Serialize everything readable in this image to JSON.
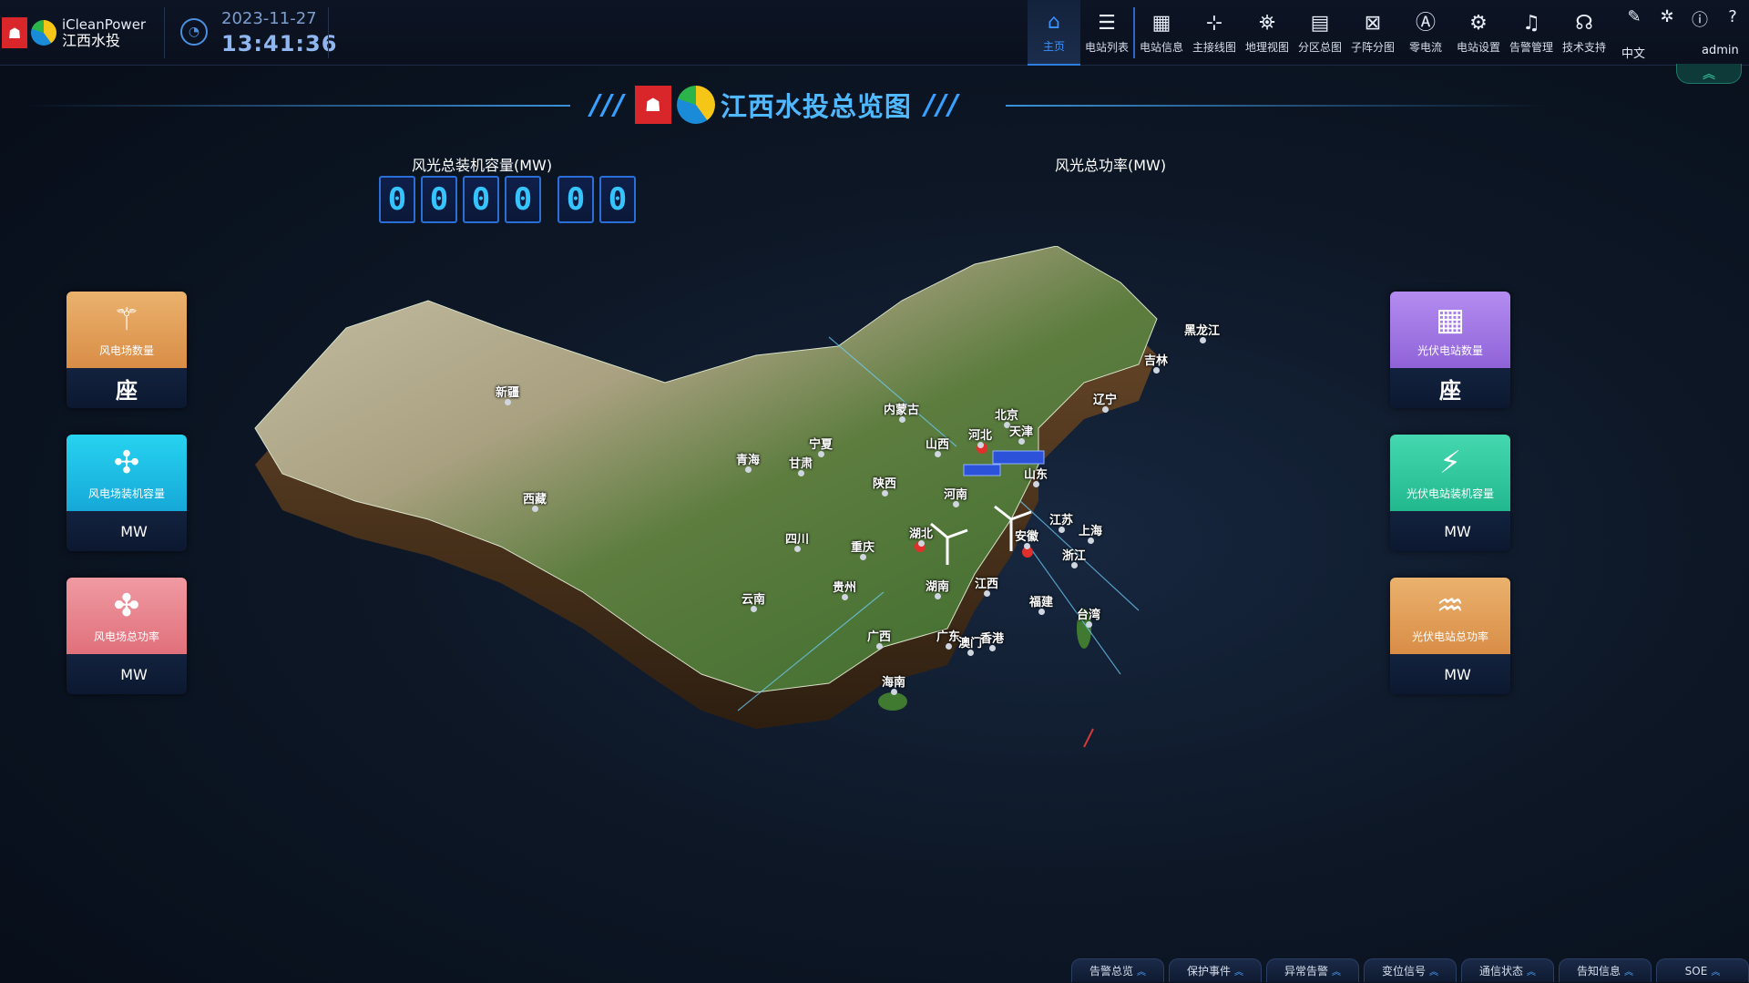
{
  "header": {
    "brand_en": "iCleanPower",
    "brand_cn": "江西水投",
    "date": "2023-11-27",
    "time": "13:41:36",
    "nav": [
      {
        "label": "主页",
        "icon": "⌂",
        "active": true
      },
      {
        "label": "电站列表",
        "icon": "☰"
      },
      {
        "label": "电站信息",
        "icon": "▦"
      },
      {
        "label": "主接线图",
        "icon": "⊹"
      },
      {
        "label": "地理视图",
        "icon": "⛯"
      },
      {
        "label": "分区总图",
        "icon": "▤"
      },
      {
        "label": "子阵分图",
        "icon": "⊠"
      },
      {
        "label": "零电流",
        "icon": "Ⓐ"
      },
      {
        "label": "电站设置",
        "icon": "⚙"
      },
      {
        "label": "告警管理",
        "icon": "♫"
      },
      {
        "label": "技术支持",
        "icon": "☊"
      }
    ],
    "lang": "中文",
    "user": "admin"
  },
  "title": {
    "slashes_left": "///",
    "text": "江西水投总览图",
    "slashes_right": "///"
  },
  "metrics": {
    "capacity_label": "风光总装机容量(MW)",
    "capacity_digits": [
      "0",
      "0",
      "0",
      "0",
      "0",
      "0"
    ],
    "power_label": "风光总功率(MW)"
  },
  "cards": {
    "wind_count": {
      "name": "风电场数量",
      "unit": "座"
    },
    "wind_capacity": {
      "name": "风电场装机容量",
      "unit": "MW"
    },
    "wind_power": {
      "name": "风电场总功率",
      "unit": "MW"
    },
    "pv_count": {
      "name": "光伏电站数量",
      "unit": "座"
    },
    "pv_capacity": {
      "name": "光伏电站装机容量",
      "unit": "MW"
    },
    "pv_power": {
      "name": "光伏电站总功率",
      "unit": "MW"
    }
  },
  "provinces": {
    "heilongjiang": "黑龙江",
    "jilin": "吉林",
    "liaoning": "辽宁",
    "neimenggu": "内蒙古",
    "beijing": "北京",
    "tianjin": "天津",
    "hebei": "河北",
    "shanxi": "山西",
    "shandong": "山东",
    "xinjiang": "新疆",
    "qinghai": "青海",
    "gansu": "甘肃",
    "ningxia": "宁夏",
    "shaanxi": "陕西",
    "henan": "河南",
    "xizang": "西藏",
    "sichuan": "四川",
    "chongqing": "重庆",
    "hubei": "湖北",
    "anhui": "安徽",
    "jiangsu": "江苏",
    "shanghai": "上海",
    "zhejiang": "浙江",
    "guizhou": "贵州",
    "hunan": "湖南",
    "jiangxi": "江西",
    "fujian": "福建",
    "taiwan": "台湾",
    "yunnan": "云南",
    "guangxi": "广西",
    "guangdong": "广东",
    "aomen": "澳门",
    "xianggang": "香港",
    "hainan": "海南"
  },
  "footer": [
    "告警总览",
    "保护事件",
    "异常告警",
    "变位信号",
    "通信状态",
    "告知信息",
    "SOE"
  ],
  "colors": {
    "accent": "#3a92ff",
    "title": "#4fb8ff",
    "card_wind_count": "#e8a45c",
    "card_wind_capacity": "#22c3e6",
    "card_wind_power": "#ee8a93",
    "card_pv_count": "#a77de6",
    "card_pv_capacity": "#35c9a0",
    "card_pv_power": "#e8a45c"
  }
}
